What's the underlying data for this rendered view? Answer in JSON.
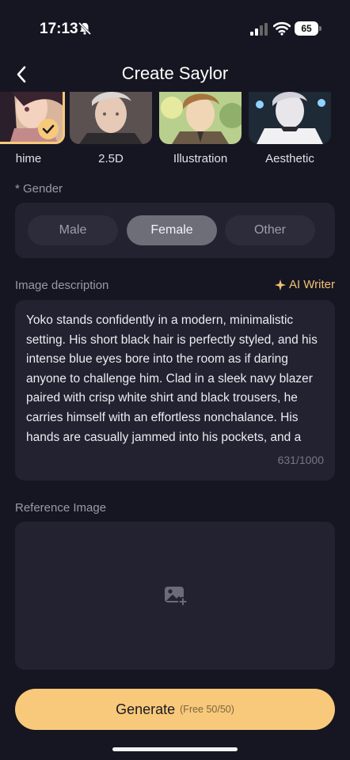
{
  "status_bar": {
    "time": "17:13",
    "battery": "65"
  },
  "header": {
    "title": "Create Saylor"
  },
  "styles": [
    {
      "label": "hime",
      "selected": true
    },
    {
      "label": "2.5D",
      "selected": false
    },
    {
      "label": "Illustration",
      "selected": false
    },
    {
      "label": "Aesthetic",
      "selected": false
    }
  ],
  "gender": {
    "label": "* Gender",
    "options": [
      "Male",
      "Female",
      "Other"
    ],
    "selected": "Female"
  },
  "description": {
    "label": "Image description",
    "ai_writer": "AI Writer",
    "text": "Yoko stands confidently in a modern, minimalistic setting. His short black hair is perfectly styled, and his intense blue eyes bore into the room as if daring anyone to challenge him. Clad in a sleek navy blazer paired with crisp white shirt and black trousers, he carries himself with an effortless nonchalance. His hands are casually jammed into his pockets, and a slight smirk graces his lips, betraying his readiness",
    "count": "631/1000"
  },
  "reference": {
    "label": "Reference Image"
  },
  "generate": {
    "label": "Generate",
    "note": "(Free 50/50)"
  },
  "colors": {
    "background": "#161622",
    "card": "#222230",
    "accent": "#f8c97a",
    "ai_writer": "#f4c174"
  }
}
